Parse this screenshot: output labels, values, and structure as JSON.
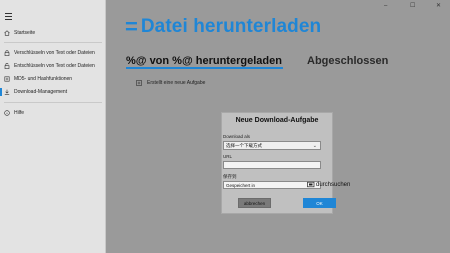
{
  "sidebar": {
    "menu_icon": "hamburger-icon",
    "items": [
      {
        "label": "Startseite",
        "icon": "home-icon",
        "active": false
      },
      {
        "label": "Verschlüsseln von Text oder Dateien",
        "icon": "lock-icon",
        "active": false
      },
      {
        "label": "Entschlüsseln von Text oder Dateien",
        "icon": "unlock-icon",
        "active": false
      },
      {
        "label": "MD5- und Hashfunktionen",
        "icon": "hash-icon",
        "active": false
      },
      {
        "label": "Download-Management",
        "icon": "download-icon",
        "active": true
      },
      {
        "label": "Hilfe",
        "icon": "help-icon",
        "active": false
      }
    ]
  },
  "window": {
    "minimize": "–",
    "maximize": "☐",
    "close": "✕"
  },
  "header": {
    "title_mark": "=",
    "title": "Datei herunterladen"
  },
  "tabs": [
    {
      "label": "%@ von %@ heruntergeladen",
      "active": true
    },
    {
      "label": "Abgeschlossen",
      "active": false
    }
  ],
  "new_task": {
    "label": "Erstellt eine neue Aufgabe",
    "icon": "add-task-icon"
  },
  "dialog": {
    "title": "Neue Download-Aufgabe",
    "download_via_label": "Download als",
    "download_via_value": "选择一个下载方式",
    "url_label": "URL",
    "url_value": "",
    "save_to_label": "保存到",
    "save_to_value": "Gespeichert in",
    "browse_label": "durchsuchen",
    "cancel_label": "abbrechen",
    "ok_label": "OK"
  },
  "colors": {
    "accent": "#1f86d6",
    "overlay": "#9a9a9a",
    "sidebar_bg": "#e3e3e3",
    "dialog_bg": "#c0c0c0"
  }
}
